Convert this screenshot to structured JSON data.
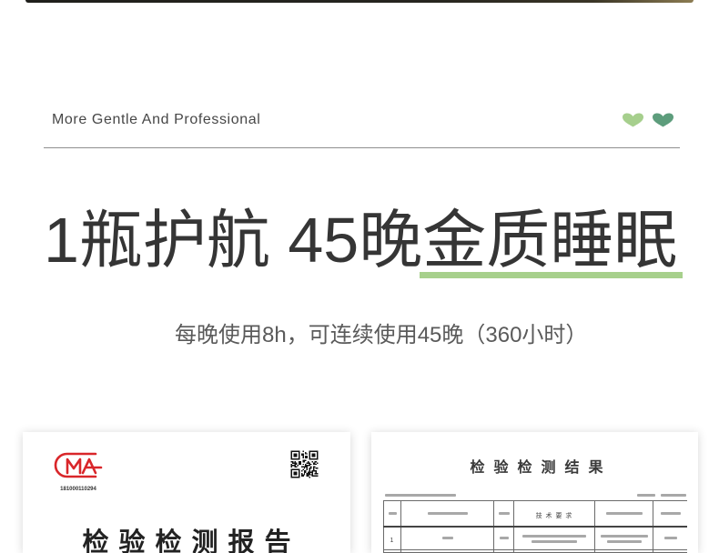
{
  "tagline": "More Gentle And Professional",
  "hearts": [
    {
      "icon": "heart-icon",
      "color": "#a6cf8d"
    },
    {
      "icon": "heart-icon",
      "color": "#5d9d7c"
    }
  ],
  "headline": {
    "text": "1瓶护航 45晚",
    "highlight_text": "金质睡眠",
    "highlight_color": "#a7d08c"
  },
  "subtitle": "每晚使用8h，可连续使用45晚（360小时）",
  "report_card": {
    "logo_text": "CMA",
    "logo_color": "#d9262a",
    "certificate_number": "181000110294",
    "qr_icon": "qr-code-icon",
    "title": "检验检测报告"
  },
  "results_card": {
    "title": "检验检测结果",
    "table": {
      "header": {
        "requirement": "技 术 要 求"
      },
      "rows": [
        {
          "index": "1"
        }
      ]
    }
  }
}
